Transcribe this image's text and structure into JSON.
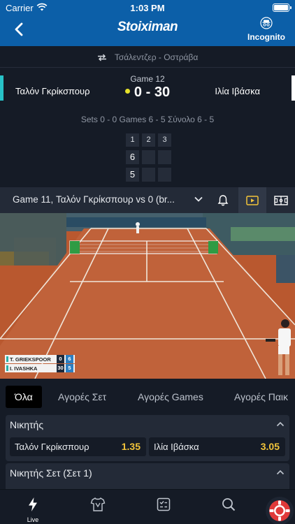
{
  "status_bar": {
    "carrier": "Carrier",
    "time": "1:03 PM"
  },
  "header": {
    "logo": "Stoiximan",
    "incognito_label": "Incognito"
  },
  "match": {
    "event": "Τσάλεντζερ - Οστράβα",
    "home": "Ταλόν Γκρίκσπουρ",
    "away": "Ιλία Ιβάσκα",
    "game_label": "Game 12",
    "point_score": "0 - 30",
    "summary": "Sets 0 - 0   Games 6 - 5 Σύνολο 6 - 5",
    "set_grid": {
      "headers": [
        "1",
        "2",
        "3"
      ],
      "home": [
        "6",
        "",
        ""
      ],
      "away": [
        "5",
        "",
        ""
      ]
    }
  },
  "video_bar": {
    "title": "Game 11, Ταλόν Γκρίκσπουρ vs 0 (br..."
  },
  "video_overlay": {
    "players": [
      {
        "name": "T. GRIEKSPOOR",
        "games": "0",
        "points": "6"
      },
      {
        "name": "I. IVASHKA",
        "games": "30",
        "points": "5"
      }
    ]
  },
  "tabs": [
    {
      "label": "Όλα",
      "active": true
    },
    {
      "label": "Αγορές Σετ",
      "active": false
    },
    {
      "label": "Αγορές Games",
      "active": false
    },
    {
      "label": "Αγορές Παικ",
      "active": false
    }
  ],
  "markets": [
    {
      "title": "Νικητής",
      "selections": [
        {
          "name": "Ταλόν Γκρίκσπουρ",
          "odds": "1.35"
        },
        {
          "name": "Ιλία Ιβάσκα",
          "odds": "3.05"
        }
      ]
    },
    {
      "title": "Νικητής Σετ (Σετ 1)"
    }
  ],
  "bottom_nav": {
    "live_label": "Live"
  },
  "colors": {
    "header_blue": "#0c5fa8",
    "background": "#151b26",
    "odds_yellow": "#f2c43a",
    "serve_dot": "#e6e22a",
    "home_accent": "#27c2c8"
  }
}
